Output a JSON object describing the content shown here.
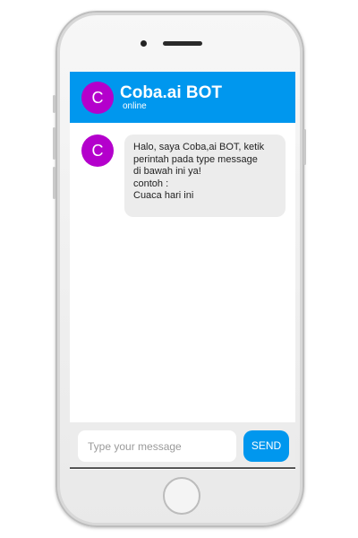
{
  "header": {
    "avatar_letter": "C",
    "bot_name": "Coba.ai BOT",
    "status": "online"
  },
  "messages": [
    {
      "sender_avatar_letter": "C",
      "lines": [
        "Halo, saya Coba,ai BOT, ketik",
        "perintah pada type message",
        "di bawah ini ya!",
        "contoh :",
        "Cuaca hari ini"
      ]
    }
  ],
  "composer": {
    "placeholder": "Type your message",
    "value": "",
    "send_label": "SEND"
  },
  "colors": {
    "accent": "#0097ee",
    "avatar": "#b400cc",
    "bubble": "#ececec",
    "composer_background": "#ececec"
  },
  "icons": {
    "front_camera": "front-camera-icon",
    "speaker": "speaker-grille-icon",
    "home_button": "home-button-icon"
  }
}
